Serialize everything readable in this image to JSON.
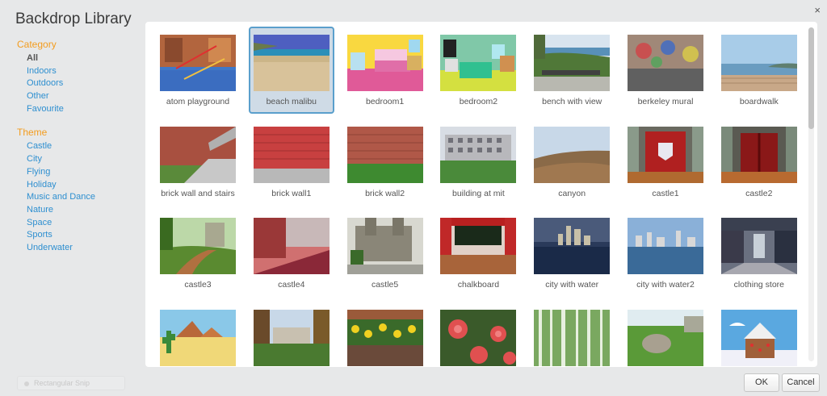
{
  "dialog": {
    "title": "Backdrop Library",
    "close_glyph": "×"
  },
  "sidebar": {
    "category_heading": "Category",
    "categories": [
      "All",
      "Indoors",
      "Outdoors",
      "Other",
      "Favourite"
    ],
    "active_category": "All",
    "theme_heading": "Theme",
    "themes": [
      "Castle",
      "City",
      "Flying",
      "Holiday",
      "Music and Dance",
      "Nature",
      "Space",
      "Sports",
      "Underwater"
    ]
  },
  "taskbar_ghost": {
    "label": "Rectangular Snip"
  },
  "backdrops": [
    {
      "name": "atom playground",
      "selected": false
    },
    {
      "name": "beach malibu",
      "selected": true
    },
    {
      "name": "bedroom1",
      "selected": false
    },
    {
      "name": "bedroom2",
      "selected": false
    },
    {
      "name": "bench with view",
      "selected": false
    },
    {
      "name": "berkeley mural",
      "selected": false
    },
    {
      "name": "boardwalk",
      "selected": false
    },
    {
      "name": "brick wall and stairs",
      "selected": false
    },
    {
      "name": "brick wall1",
      "selected": false
    },
    {
      "name": "brick wall2",
      "selected": false
    },
    {
      "name": "building at mit",
      "selected": false
    },
    {
      "name": "canyon",
      "selected": false
    },
    {
      "name": "castle1",
      "selected": false
    },
    {
      "name": "castle2",
      "selected": false
    },
    {
      "name": "castle3",
      "selected": false
    },
    {
      "name": "castle4",
      "selected": false
    },
    {
      "name": "castle5",
      "selected": false
    },
    {
      "name": "chalkboard",
      "selected": false
    },
    {
      "name": "city with water",
      "selected": false
    },
    {
      "name": "city with water2",
      "selected": false
    },
    {
      "name": "clothing store",
      "selected": false
    },
    {
      "name": "",
      "selected": false
    },
    {
      "name": "",
      "selected": false
    },
    {
      "name": "",
      "selected": false
    },
    {
      "name": "",
      "selected": false
    },
    {
      "name": "",
      "selected": false
    },
    {
      "name": "",
      "selected": false
    },
    {
      "name": "",
      "selected": false
    }
  ],
  "buttons": {
    "ok": "OK",
    "cancel": "Cancel"
  },
  "colors": {
    "accent_heading": "#f39c1e",
    "link": "#2e8fd0",
    "selection_border": "#5a9fcc"
  }
}
